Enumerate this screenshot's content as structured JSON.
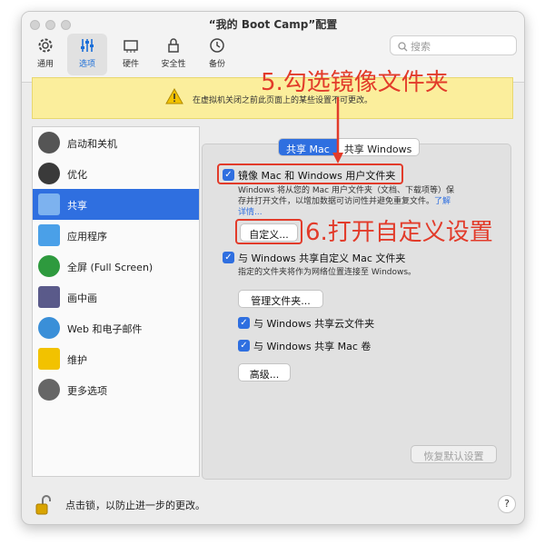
{
  "window": {
    "title": "“我的 Boot Camp”配置"
  },
  "toolbar": {
    "items": [
      {
        "label": "通用",
        "icon": "gear-icon"
      },
      {
        "label": "选项",
        "icon": "sliders-icon",
        "selected": true
      },
      {
        "label": "硬件",
        "icon": "chip-icon"
      },
      {
        "label": "安全性",
        "icon": "lock-icon"
      },
      {
        "label": "备份",
        "icon": "clock-backup-icon"
      }
    ],
    "search_placeholder": "搜索"
  },
  "warning": {
    "text": "在虚拟机关闭之前此页面上的某些设置不可更改。",
    "icon": "warning-icon"
  },
  "sidebar": {
    "items": [
      {
        "label": "启动和关机",
        "icon": "power-icon"
      },
      {
        "label": "优化",
        "icon": "speedometer-icon"
      },
      {
        "label": "共享",
        "icon": "shared-folder-icon",
        "selected": true
      },
      {
        "label": "应用程序",
        "icon": "applications-icon"
      },
      {
        "label": "全屏 (Full Screen)",
        "icon": "fullscreen-icon"
      },
      {
        "label": "画中画",
        "icon": "picture-in-picture-icon"
      },
      {
        "label": "Web 和电子邮件",
        "icon": "web-mail-icon"
      },
      {
        "label": "维护",
        "icon": "maintenance-icon"
      },
      {
        "label": "更多选项",
        "icon": "more-options-icon"
      }
    ]
  },
  "tabs": {
    "share_mac": "共享 Mac",
    "share_windows": "共享 Windows"
  },
  "options": {
    "mirror": {
      "label": "镜像 Mac 和 Windows 用户文件夹",
      "checked": true,
      "desc_line1": "Windows 将从您的 Mac 用户文件夹（文档、下载项等）保",
      "desc_line2": "存并打开文件，以增加数据可访问性并避免重复文件。",
      "link_part1": "了解",
      "link_part2": "详情..."
    },
    "customize_button": "自定义...",
    "share_custom": {
      "label": "与 Windows 共享自定义 Mac 文件夹",
      "checked": true,
      "desc": "指定的文件夹将作为网络位置连接至 Windows。"
    },
    "manage_button": "管理文件夹...",
    "share_cloud": {
      "label": "与 Windows 共享云文件夹",
      "checked": true
    },
    "share_volumes": {
      "label": "与 Windows 共享 Mac 卷",
      "checked": true
    },
    "advanced_button": "高级...",
    "restore_button": "恢复默认设置"
  },
  "annotations": {
    "step5": "5.勾选镜像文件夹",
    "step6": "6.打开自定义设置",
    "color": "#e23b2a"
  },
  "bottom": {
    "lock_text": "点击锁，以防止进一步的更改。",
    "help": "?"
  },
  "colors": {
    "accent": "#2f6fe0",
    "warning_bg": "#fbee9c",
    "annotation": "#e23b2a"
  }
}
